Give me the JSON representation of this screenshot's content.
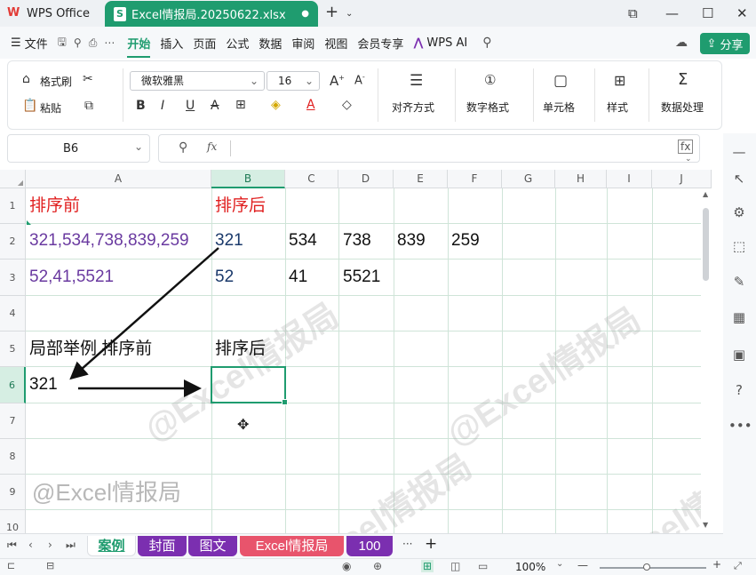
{
  "titlebar": {
    "app_tab": "WPS Office",
    "file_tab": "Excel情报局.20250622.xlsx",
    "new_tab": "+"
  },
  "menu": {
    "file": "文件",
    "items": [
      "开始",
      "插入",
      "页面",
      "公式",
      "数据",
      "审阅",
      "视图",
      "会员专享"
    ],
    "wps_ai": "WPS AI",
    "share": "分享"
  },
  "ribbon": {
    "format_painter": "格式刷",
    "paste": "粘贴",
    "font_name": "微软雅黑",
    "font_size": "16",
    "align": "对齐方式",
    "number_format": "数字格式",
    "cell": "单元格",
    "style": "样式",
    "data_process": "数据处理",
    "bold": "B",
    "italic": "I",
    "underline": "U",
    "strike": "A",
    "grow": "A",
    "shrink": "A"
  },
  "formula": {
    "cell_ref": "B6",
    "fx": "fx",
    "content": ""
  },
  "grid": {
    "columns": [
      "A",
      "B",
      "C",
      "D",
      "E",
      "F",
      "G",
      "H",
      "I",
      "J"
    ],
    "rows": [
      "1",
      "2",
      "3",
      "4",
      "5",
      "6",
      "7",
      "8",
      "9",
      "10"
    ],
    "cells": {
      "A1": "排序前",
      "B1": "排序后",
      "A2": "321,534,738,839,259",
      "B2": "321",
      "C2": "534",
      "D2": "738",
      "E2": "839",
      "F2": "259",
      "A3": "52,41,5521",
      "B3": "52",
      "C3": "41",
      "D3": "5521",
      "A5": "局部举例 排序前",
      "B5": "排序后",
      "A6": "321",
      "A9": "@Excel情报局"
    },
    "watermark": "@Excel情报局"
  },
  "sheets": {
    "tabs": [
      {
        "label": "案例",
        "color": "#ffffff"
      },
      {
        "label": "封面",
        "color": "#7b2fb0"
      },
      {
        "label": "图文",
        "color": "#7b2fb0"
      },
      {
        "label": "Excel情报局",
        "color": "#e8546c"
      },
      {
        "label": "100",
        "color": "#7b2fb0"
      }
    ],
    "more": "···",
    "add": "+"
  },
  "status": {
    "zoom": "100%"
  },
  "colors": {
    "accent": "#1f9c6f",
    "header_red": "#e02020",
    "value_purple": "#6a3aa0",
    "value_navy": "#1b3a6b"
  }
}
